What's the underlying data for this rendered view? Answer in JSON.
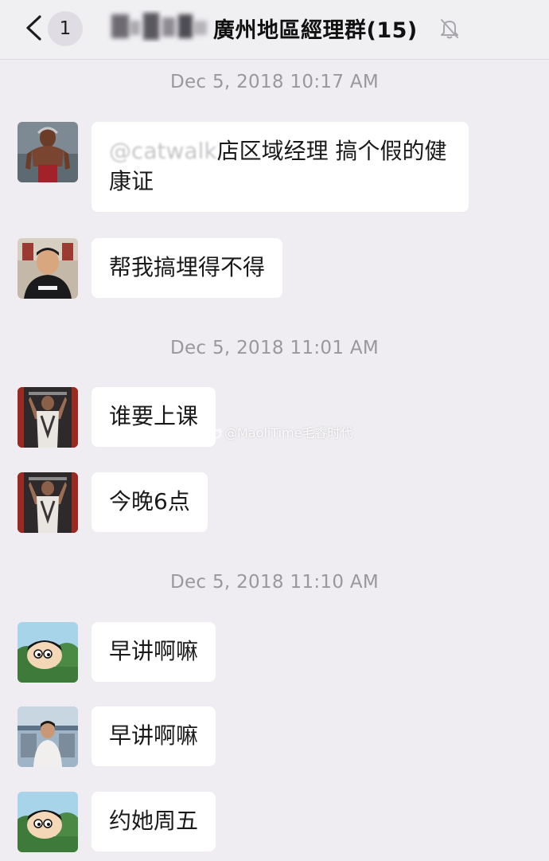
{
  "header": {
    "unread_count": "1",
    "title": "廣州地區經理群(15)",
    "blurred_name": "",
    "icons": {
      "back": "chevron-left-icon",
      "mute": "bell-slash-icon"
    }
  },
  "timestamps": [
    "Dec 5, 2018 10:17 AM",
    "Dec 5, 2018 11:01 AM",
    "Dec 5, 2018 11:10 AM"
  ],
  "messages": [
    {
      "mention": "@catwalk",
      "text": "店区域经理 搞个假的健康证",
      "avatar": "avatar-muscle-gladiator"
    },
    {
      "text": "帮我搞埋得不得",
      "avatar": "avatar-man-supreme"
    },
    {
      "text": "谁要上课",
      "avatar": "avatar-gym-back"
    },
    {
      "text": "今晚6点",
      "avatar": "avatar-gym-back"
    },
    {
      "text": "早讲啊嘛",
      "avatar": "avatar-cartoon-kid"
    },
    {
      "text": "早讲啊嘛",
      "avatar": "avatar-man-seated"
    },
    {
      "text": "约她周五",
      "avatar": "avatar-cartoon-kid"
    }
  ],
  "watermark": "@MaoliTime毛睿时代",
  "colors": {
    "background": "#efedf1",
    "bubble": "#ffffff",
    "timestamp": "#9a989d",
    "text": "#1a1a1a"
  }
}
